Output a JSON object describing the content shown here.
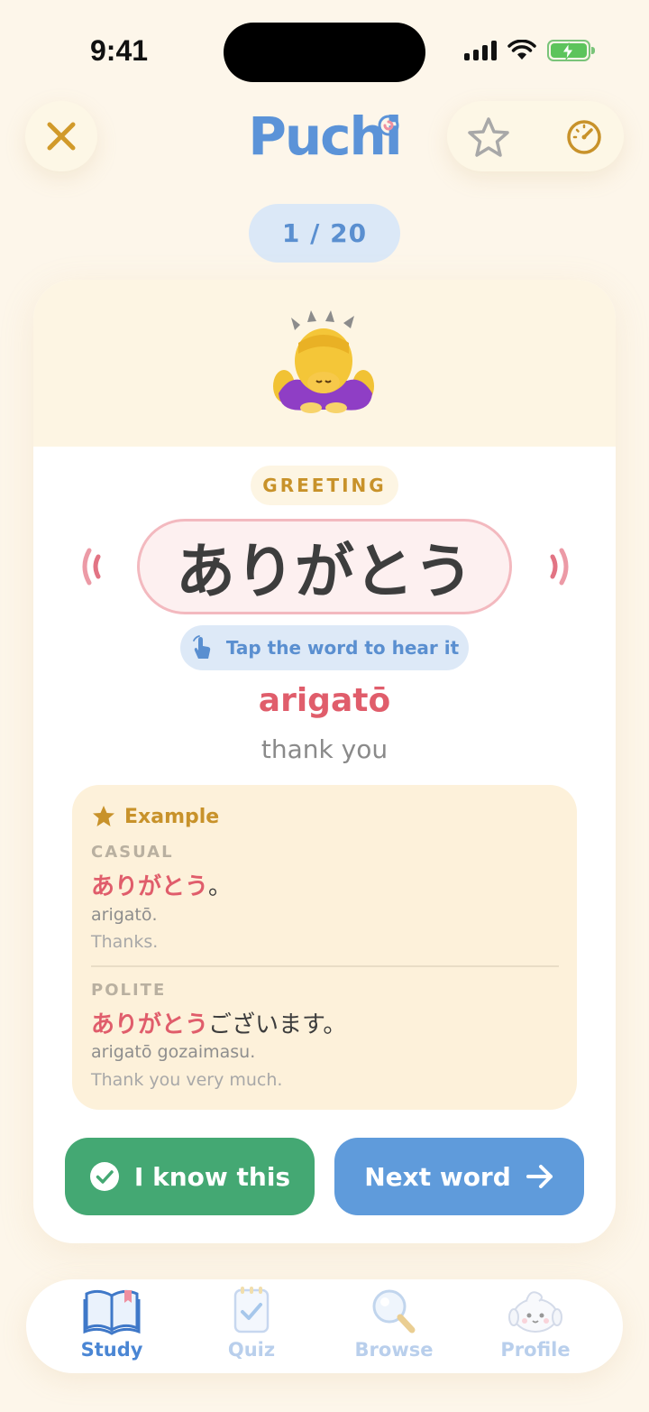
{
  "status": {
    "time": "9:41"
  },
  "header": {
    "logo": "Puchi",
    "close_icon": "close-icon",
    "favorite_icon": "star-icon",
    "speed_icon": "speedometer-icon"
  },
  "progress": {
    "label": "1 / 20",
    "current": 1,
    "total": 20
  },
  "card": {
    "emoji_icon": "person-bowing-emoji",
    "category": "GREETING",
    "word": "ありがとう",
    "tap_hint": "Tap the word to hear it",
    "romaji": "arigatō",
    "meaning": "thank you",
    "example": {
      "title": "Example",
      "casual": {
        "level": "CASUAL",
        "jp_highlight": "ありがとう",
        "jp_rest": "。",
        "romaji": "arigatō.",
        "english": "Thanks."
      },
      "polite": {
        "level": "POLITE",
        "jp_highlight": "ありがとう",
        "jp_rest": "ございます。",
        "romaji": "arigatō gozaimasu.",
        "english": "Thank you very much."
      }
    },
    "know_button": "I know this",
    "next_button": "Next word"
  },
  "tabs": [
    {
      "label": "Study",
      "icon": "book-icon",
      "active": true
    },
    {
      "label": "Quiz",
      "icon": "clipboard-check-icon",
      "active": false
    },
    {
      "label": "Browse",
      "icon": "magnifier-icon",
      "active": false
    },
    {
      "label": "Profile",
      "icon": "mascot-avatar-icon",
      "active": false
    }
  ],
  "colors": {
    "background": "#fdf6ea",
    "accent_blue": "#5f9bdb",
    "accent_green": "#44a873",
    "accent_pink": "#e05d6b",
    "accent_gold": "#c8922a"
  }
}
